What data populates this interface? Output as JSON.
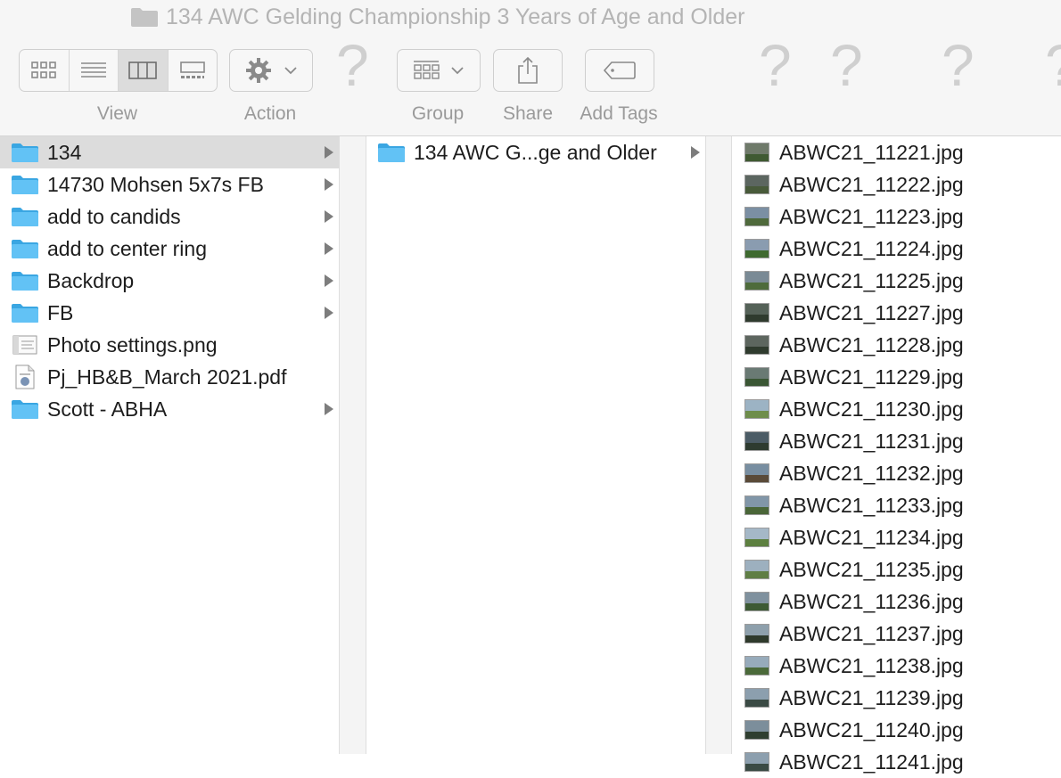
{
  "window": {
    "title": "134 AWC Gelding Championship 3 Years of Age and Older"
  },
  "toolbar": {
    "view_label": "View",
    "action_label": "Action",
    "group_label": "Group",
    "share_label": "Share",
    "tags_label": "Add Tags",
    "view_modes": [
      "icon-view-icon",
      "list-view-icon",
      "column-view-icon",
      "gallery-view-icon"
    ],
    "selected_view": "column-view-icon",
    "unknown_item": "?"
  },
  "columns": {
    "col1": {
      "items": [
        {
          "name": "134",
          "kind": "folder",
          "selected": true
        },
        {
          "name": "14730 Mohsen 5x7s FB",
          "kind": "folder"
        },
        {
          "name": "add to candids",
          "kind": "folder"
        },
        {
          "name": "add to center ring",
          "kind": "folder"
        },
        {
          "name": "Backdrop",
          "kind": "folder"
        },
        {
          "name": "FB",
          "kind": "folder"
        },
        {
          "name": "Photo settings.png",
          "kind": "png"
        },
        {
          "name": "Pj_HB&B_March 2021.pdf",
          "kind": "pdf"
        },
        {
          "name": "Scott - ABHA",
          "kind": "folder"
        }
      ]
    },
    "col2": {
      "items": [
        {
          "name": "134 AWC G...ge and Older",
          "kind": "folder"
        }
      ]
    },
    "col3": {
      "items": [
        "ABWC21_11221.jpg",
        "ABWC21_11222.jpg",
        "ABWC21_11223.jpg",
        "ABWC21_11224.jpg",
        "ABWC21_11225.jpg",
        "ABWC21_11227.jpg",
        "ABWC21_11228.jpg",
        "ABWC21_11229.jpg",
        "ABWC21_11230.jpg",
        "ABWC21_11231.jpg",
        "ABWC21_11232.jpg",
        "ABWC21_11233.jpg",
        "ABWC21_11234.jpg",
        "ABWC21_11235.jpg",
        "ABWC21_11236.jpg",
        "ABWC21_11237.jpg",
        "ABWC21_11238.jpg",
        "ABWC21_11239.jpg",
        "ABWC21_11240.jpg",
        "ABWC21_11241.jpg"
      ]
    }
  },
  "colors": {
    "folder": "#62c2f5",
    "folder_dark": "#3aa6e2",
    "selection": "#dcdcdc"
  }
}
